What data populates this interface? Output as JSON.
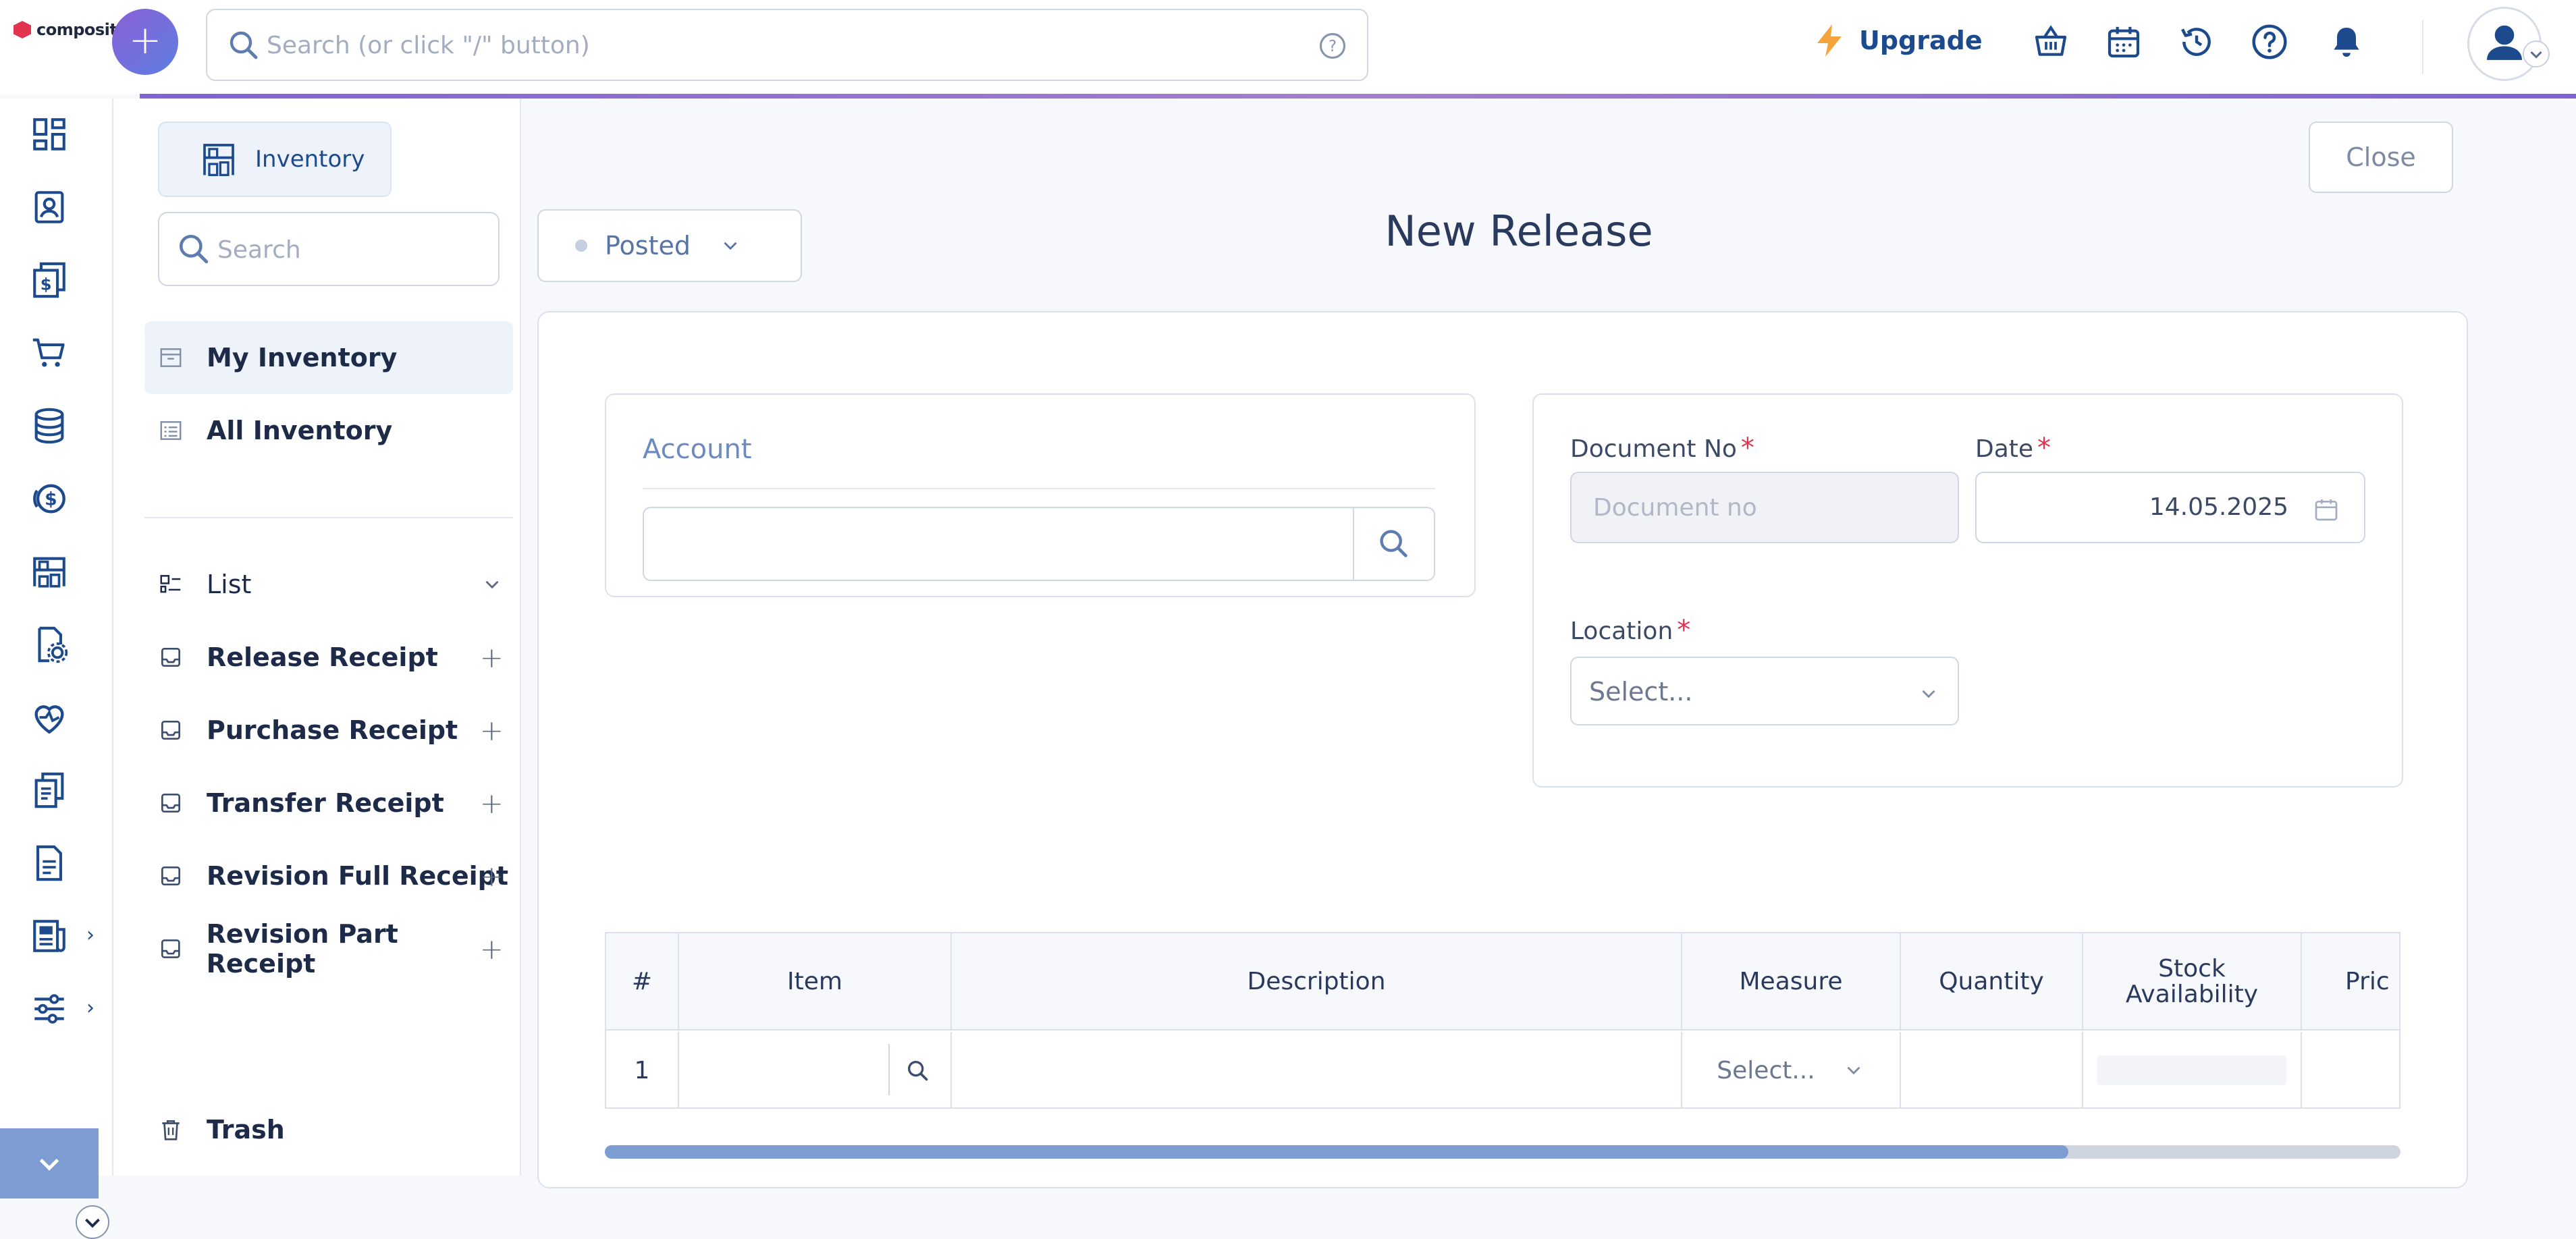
{
  "app": {
    "logo_text": "composity"
  },
  "topbar": {
    "search_placeholder": "Search (or click \"/\" button)",
    "upgrade_label": "Upgrade",
    "icons": [
      "basket-icon",
      "calendar-icon",
      "history-icon",
      "help-icon",
      "bell-icon"
    ]
  },
  "rail": {
    "icons": [
      "dashboard-icon",
      "contacts-icon",
      "invoice-icon",
      "cart-icon",
      "database-icon",
      "finance-icon",
      "inventory-icon",
      "settings-doc-icon",
      "health-icon",
      "documents-icon",
      "report-icon",
      "news-icon",
      "filters-icon"
    ]
  },
  "module": {
    "name": "Inventory",
    "search_placeholder": "Search",
    "nav": [
      {
        "label": "My Inventory",
        "active": true
      },
      {
        "label": "All Inventory",
        "active": false
      }
    ],
    "list_label": "List",
    "receipts": [
      {
        "label": "Release Receipt"
      },
      {
        "label": "Purchase Receipt"
      },
      {
        "label": "Transfer Receipt"
      },
      {
        "label": "Revision Full Receipt"
      },
      {
        "label": "Revision Part Receipt"
      }
    ],
    "trash_label": "Trash"
  },
  "main": {
    "close_label": "Close",
    "status_value": "Posted",
    "title": "New Release",
    "account": {
      "label": "Account",
      "value": ""
    },
    "document_no": {
      "label": "Document No",
      "required": "*",
      "placeholder": "Document no",
      "value": ""
    },
    "date": {
      "label": "Date",
      "required": "*",
      "value": "14.05.2025"
    },
    "location": {
      "label": "Location",
      "required": "*",
      "value": "Select..."
    },
    "table": {
      "columns": [
        "#",
        "Item",
        "Description",
        "Measure",
        "Quantity",
        "Stock Availability",
        "Pric"
      ],
      "rows": [
        {
          "num": "1",
          "item": "",
          "description": "",
          "measure": "Select...",
          "quantity": "",
          "stock": "",
          "price": ""
        }
      ]
    },
    "scroll_fraction": 0.815
  },
  "colors": {
    "accent": "#1d4a8c",
    "purple": "#8b5fd8",
    "required": "#e0334d",
    "upgrade_bolt": "#f5a33b"
  }
}
